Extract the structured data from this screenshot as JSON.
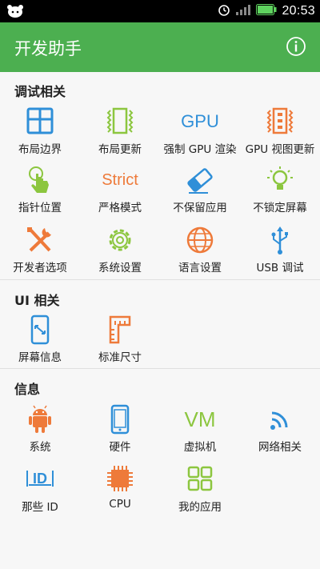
{
  "status_bar": {
    "time": "20:53"
  },
  "app_bar": {
    "title": "开发助手"
  },
  "colors": {
    "primary": "#4caf50",
    "blue": "#2f8fd8",
    "orange": "#ee7a3a",
    "green": "#8cc63f"
  },
  "sections": {
    "debug": {
      "title": "调试相关",
      "items": [
        {
          "label": "布局边界",
          "icon": "layout-bounds-icon"
        },
        {
          "label": "布局更新",
          "icon": "layout-update-icon"
        },
        {
          "label": "强制 GPU 渲染",
          "icon_text": "GPU"
        },
        {
          "label": "GPU 视图更新",
          "icon": "gpu-view-update-icon"
        },
        {
          "label": "指针位置",
          "icon": "pointer-hand-icon"
        },
        {
          "label": "严格模式",
          "icon_text": "Strict"
        },
        {
          "label": "不保留应用",
          "icon": "eraser-icon"
        },
        {
          "label": "不锁定屏幕",
          "icon": "lightbulb-icon"
        },
        {
          "label": "开发者选项",
          "icon": "tools-icon"
        },
        {
          "label": "系统设置",
          "icon": "gear-icon"
        },
        {
          "label": "语言设置",
          "icon": "globe-icon"
        },
        {
          "label": "USB 调试",
          "icon": "usb-icon"
        }
      ]
    },
    "ui": {
      "title": "UI 相关",
      "items": [
        {
          "label": "屏幕信息",
          "icon": "phone-screen-icon"
        },
        {
          "label": "标准尺寸",
          "icon": "ruler-icon"
        }
      ]
    },
    "info": {
      "title": "信息",
      "items": [
        {
          "label": "系统",
          "icon": "android-icon"
        },
        {
          "label": "硬件",
          "icon": "phone-icon"
        },
        {
          "label": "虚拟机",
          "icon_text": "VM"
        },
        {
          "label": "网络相关",
          "icon": "wifi-icon"
        },
        {
          "label": "那些 ID",
          "icon": "id-icon"
        },
        {
          "label": "CPU",
          "icon": "cpu-chip-icon"
        },
        {
          "label": "我的应用",
          "icon": "apps-grid-icon"
        }
      ]
    }
  }
}
